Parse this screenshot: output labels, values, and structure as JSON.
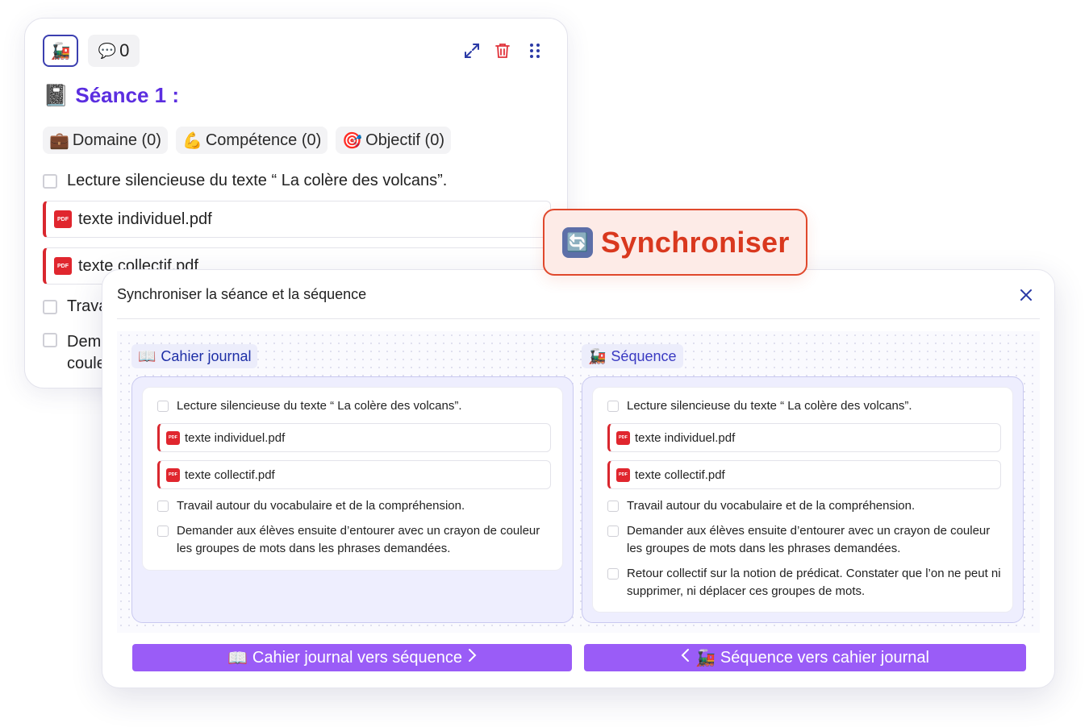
{
  "card": {
    "train_emoji": "🚂",
    "comment_emoji": "💬",
    "comment_count": "0",
    "title_emoji": "📓",
    "title": "Séance 1 :",
    "tags": [
      {
        "emoji": "💼",
        "label": "Domaine (0)"
      },
      {
        "emoji": "💪",
        "label": "Compétence (0)"
      },
      {
        "emoji": "🎯",
        "label": "Objectif (0)"
      }
    ],
    "row1": "Lecture silencieuse du texte “ La colère des volcans”.",
    "file1": "texte individuel.pdf",
    "file2": "texte collectif.pdf",
    "row3_partial": "Trava",
    "row4_partial_a": "Dem",
    "row4_partial_b": "coule"
  },
  "sync_badge": {
    "emoji": "🔄",
    "label": "Synchroniser"
  },
  "modal": {
    "title": "Synchroniser la séance et la séquence",
    "left": {
      "emoji": "📖",
      "label": "Cahier journal",
      "row1": "Lecture silencieuse du texte “ La colère des volcans”.",
      "file1": "texte individuel.pdf",
      "file2": "texte collectif.pdf",
      "row2": "Travail autour du vocabulaire et de la compréhension.",
      "row3": "Demander aux élèves ensuite d’entourer avec un crayon de couleur les groupes de mots dans les phrases demandées."
    },
    "right": {
      "emoji": "🚂",
      "label": "Séquence",
      "row1": "Lecture silencieuse du texte “ La colère des volcans”.",
      "file1": "texte individuel.pdf",
      "file2": "texte collectif.pdf",
      "row2": "Travail autour du vocabulaire et de la compréhension.",
      "row3": "Demander aux élèves ensuite d’entourer avec un crayon de couleur les groupes de mots dans les phrases demandées.",
      "row4": "Retour collectif sur la notion de prédicat. Constater que l’on ne peut ni supprimer, ni déplacer ces groupes de mots."
    },
    "btn_left": {
      "emoji": "📖",
      "label": "Cahier journal vers séquence"
    },
    "btn_right": {
      "emoji": "🚂",
      "label": "Séquence vers cahier journal"
    }
  },
  "pdf_tag": "PDF",
  "colors": {
    "accent": "#5b2ee0",
    "button": "#9a5cf7",
    "danger": "#d9381e"
  }
}
